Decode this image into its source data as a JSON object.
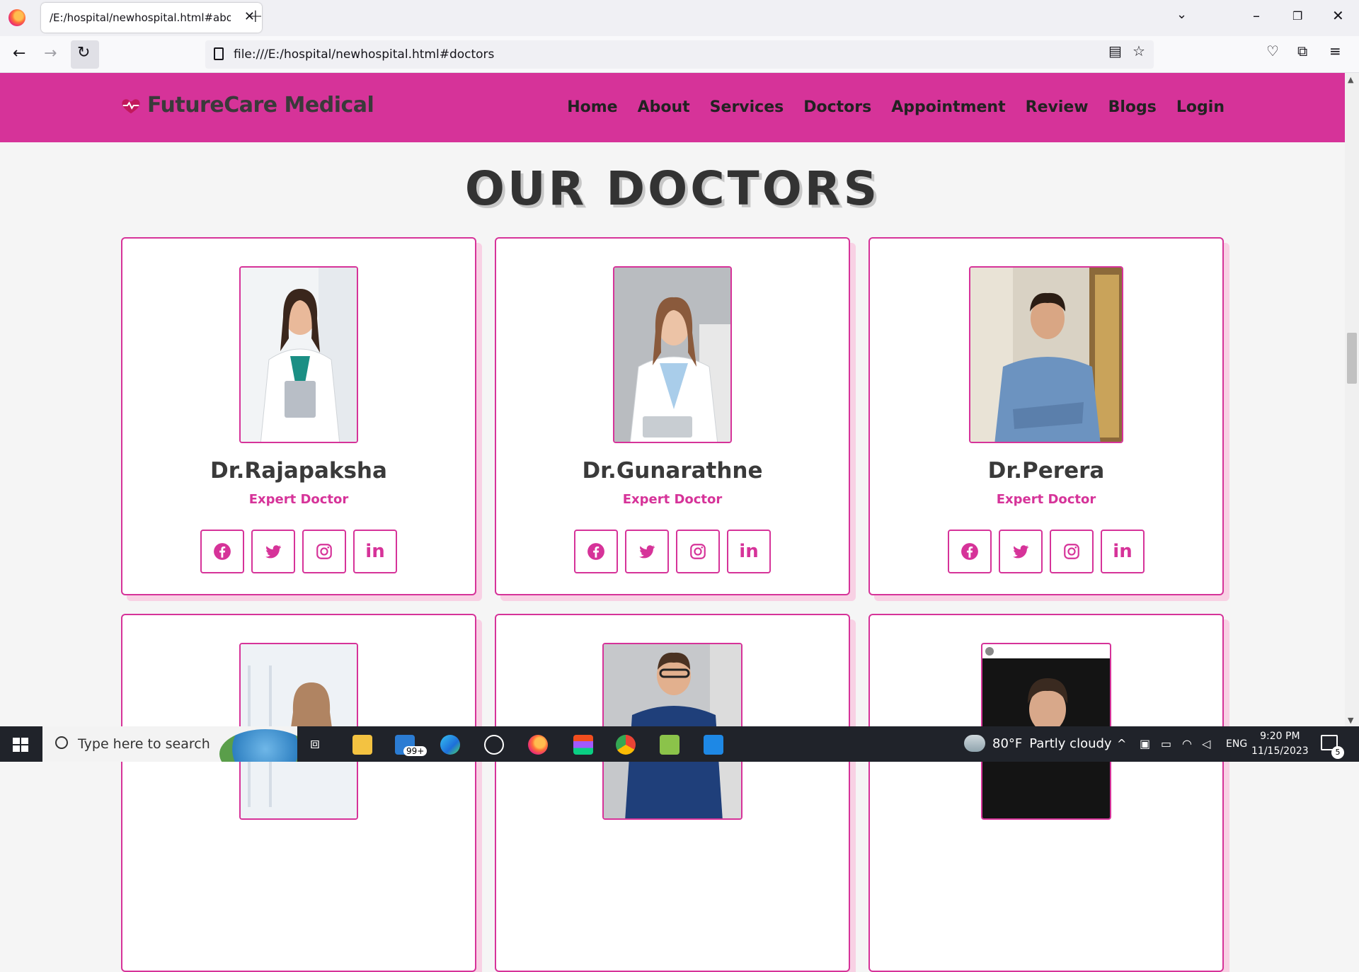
{
  "browser": {
    "tab_title": "/E:/hospital/newhospital.html#about",
    "url": "file:///E:/hospital/newhospital.html#doctors"
  },
  "site": {
    "brand": "FutureCare Medical",
    "nav": [
      "Home",
      "About",
      "Services",
      "Doctors",
      "Appointment",
      "Review",
      "Blogs",
      "Login"
    ],
    "section_title": "OUR DOCTORS",
    "colors": {
      "accent": "#d63399",
      "text_dark": "#3a3a3a",
      "shadow": "#f8d1e4"
    }
  },
  "doctors": [
    {
      "name": "Dr.Rajapaksha",
      "role": "Expert Doctor"
    },
    {
      "name": "Dr.Gunarathne",
      "role": "Expert Doctor"
    },
    {
      "name": "Dr.Perera",
      "role": "Expert Doctor"
    }
  ],
  "social_icons": [
    "facebook-icon",
    "twitter-icon",
    "instagram-icon",
    "linkedin-icon"
  ],
  "taskbar": {
    "search_placeholder": "Type here to search",
    "mail_badge": "99+",
    "weather_temp": "80°F",
    "weather_desc": "Partly cloudy",
    "language": "ENG",
    "time": "9:20 PM",
    "date": "11/15/2023",
    "notification_count": "5"
  }
}
